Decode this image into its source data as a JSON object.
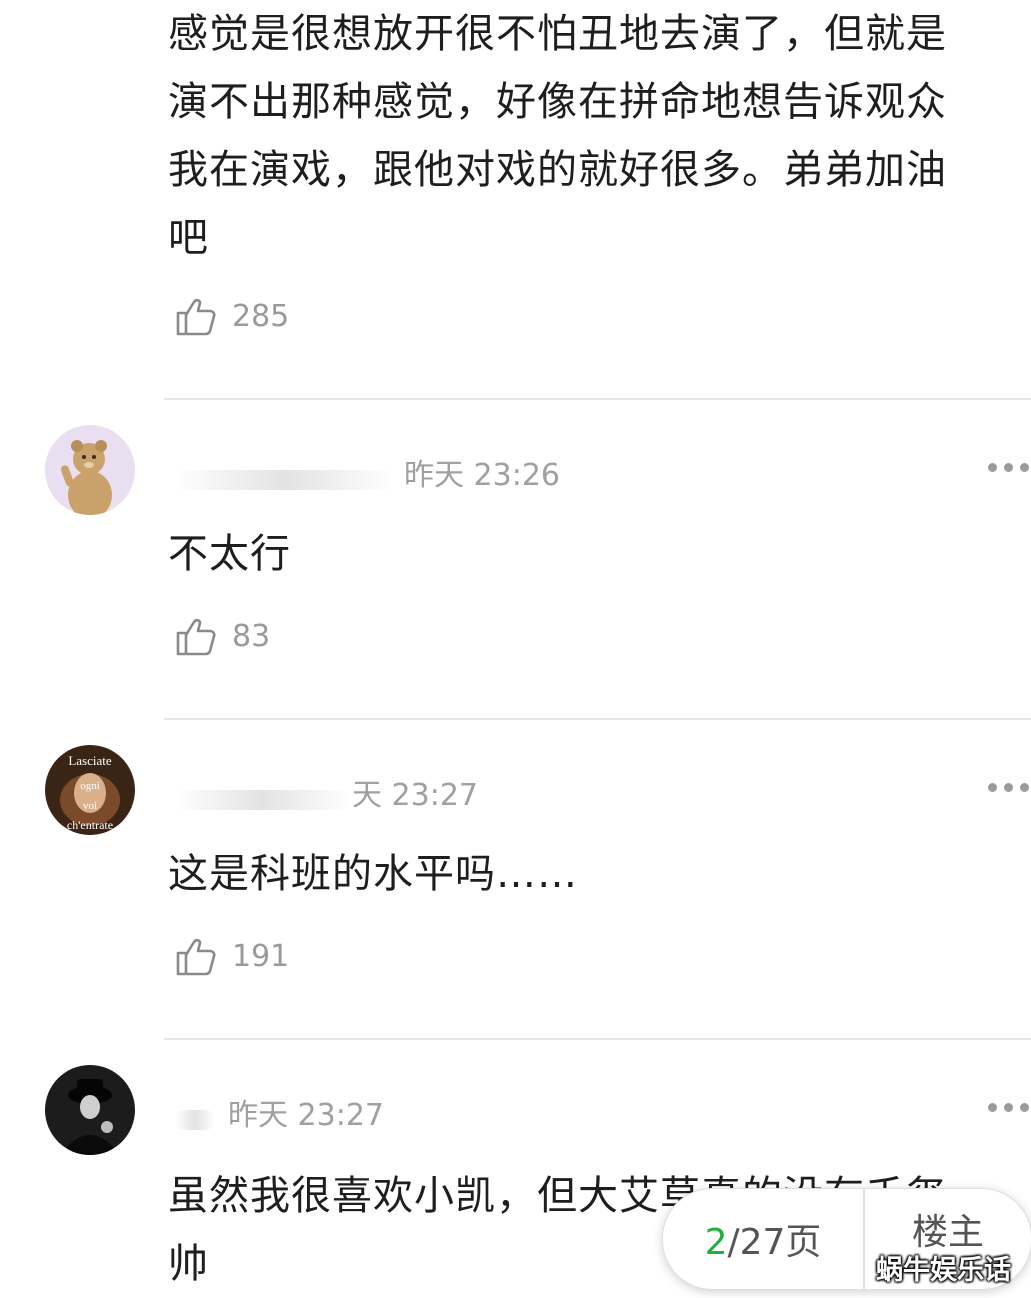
{
  "comments": [
    {
      "text_lines": [
        "感觉是很想放开很不怕丑地去演了，但就是",
        "演不出那种感觉，好像在拼命地想告诉观众",
        "我在演戏，跟他对戏的就好很多。弟弟加油",
        "吧"
      ],
      "likes": "285"
    },
    {
      "time": "昨天 23:26",
      "text": "不太行",
      "likes": "83",
      "avatar_icon": "teddy-bear-avatar"
    },
    {
      "time": "天 23:27",
      "text": "这是科班的水平吗……",
      "likes": "191",
      "avatar_icon": "art-photo-avatar",
      "avatar_text": [
        "Lasciate",
        "ogni",
        "voi",
        "ch'entrate"
      ]
    },
    {
      "time": "昨天 23:27",
      "text_lines": [
        "虽然我很喜欢小凯，但大艾草真的没有千玺",
        "帅"
      ],
      "avatar_icon": "person-in-hat-avatar"
    }
  ],
  "pager": {
    "current": "2",
    "total": "/27页",
    "owner_label": "楼主"
  },
  "watermark": "蜗牛娱乐话",
  "colors": {
    "accent": "#21b03a",
    "muted": "#a0a0a0"
  }
}
